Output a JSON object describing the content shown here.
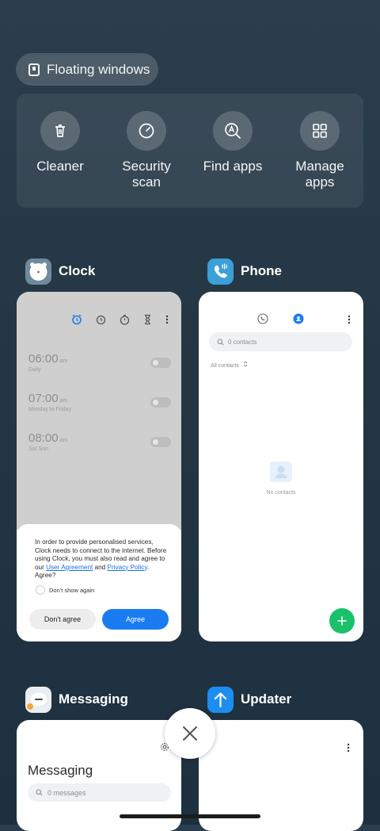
{
  "floating_windows": {
    "label": "Floating windows",
    "icon": "floating-window-icon"
  },
  "tools": [
    {
      "label": "Cleaner",
      "icon": "trash-icon"
    },
    {
      "label": "Security\nscan",
      "icon": "security-scan-icon"
    },
    {
      "label": "Find apps",
      "icon": "find-apps-icon"
    },
    {
      "label": "Manage\napps",
      "icon": "grid-icon"
    }
  ],
  "apps": {
    "clock": {
      "name": "Clock",
      "alarms": [
        {
          "time": "06:00",
          "ampm": "am",
          "repeat": "Daily",
          "enabled": false
        },
        {
          "time": "07:00",
          "ampm": "am",
          "repeat": "Monday to Friday",
          "enabled": false
        },
        {
          "time": "08:00",
          "ampm": "am",
          "repeat": "Sat Sun",
          "enabled": false
        }
      ],
      "dialog": {
        "text_before": "In order to provide personalised services, Clock needs to connect to the internet. Before using Clock, you must also read and agree to our ",
        "user_agreement": "User Agreement",
        "text_and": " and ",
        "privacy_policy": "Privacy Policy",
        "text_after": ". Agree?",
        "checkbox_label": "Don't show again",
        "cancel": "Don't agree",
        "confirm": "Agree"
      }
    },
    "phone": {
      "name": "Phone",
      "search_placeholder": "0 contacts",
      "filter": "All contacts",
      "empty": "No contacts"
    },
    "messaging": {
      "name": "Messaging",
      "title": "Messaging",
      "search_placeholder": "0 messages"
    },
    "updater": {
      "name": "Updater"
    }
  },
  "colors": {
    "accent_blue": "#1b7cf2",
    "fab_green": "#19c16a"
  }
}
